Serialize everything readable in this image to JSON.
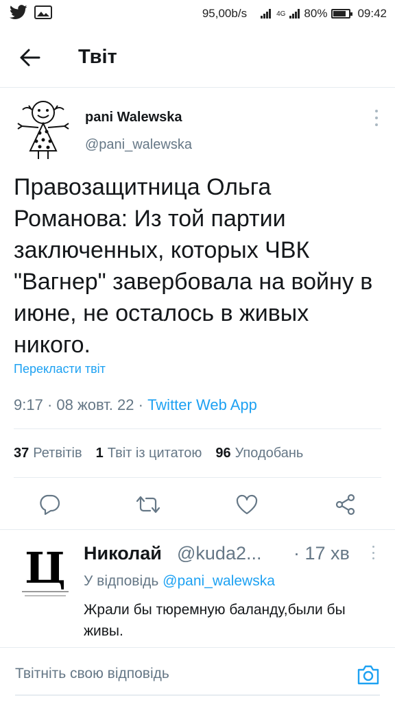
{
  "status_bar": {
    "net_speed": "95,00b/s",
    "network_type": "4G",
    "battery_percent": "80%",
    "battery_level": 0.8,
    "time": "09:42",
    "icons": [
      "twitter-bird-icon",
      "image-icon",
      "signal-icon",
      "signal-4g-icon",
      "battery-icon"
    ]
  },
  "header": {
    "title": "Твіт",
    "back_icon": "arrow-left-icon"
  },
  "tweet": {
    "author_name": "pani Walewska",
    "author_handle": "@pani_walewska",
    "text": "Правозащитница Ольга Романова: Из той партии заключенных, которых ЧВК \"Вагнер\" завербовала на войну в июне, не осталось в живых никого.",
    "translate_label": "Перекласти твіт",
    "time": "9:17",
    "date": "08 жовт. 22",
    "app": "Twitter Web App",
    "stats": {
      "retweets_count": "37",
      "retweets_label": "Ретвітів",
      "quotes_count": "1",
      "quotes_label": "Твіт із цитатою",
      "likes_count": "96",
      "likes_label": "Уподобань"
    }
  },
  "reply": {
    "name": "Николай",
    "handle": "@kuda2...",
    "time": "17 хв",
    "reply_prefix": "У відповідь",
    "reply_to": "@pani_walewska",
    "text": "Жрали бы тюремную баланду,были бы живы.",
    "avatar_letter": "Ц"
  },
  "compose": {
    "placeholder": "Твітніть свою відповідь",
    "camera_icon": "camera-icon"
  },
  "colors": {
    "accent": "#1da1f2",
    "secondary_text": "#657786",
    "divider": "#e6ecf0"
  }
}
